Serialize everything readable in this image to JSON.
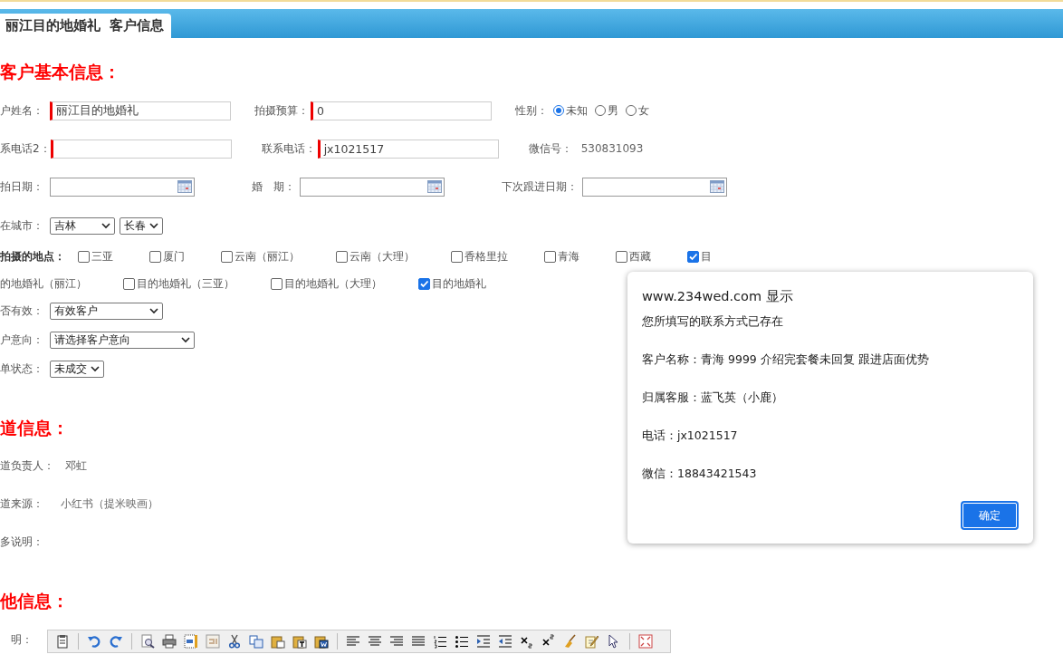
{
  "tab": {
    "title": "丽江目的地婚礼  客户信息"
  },
  "basic": {
    "heading": "客户基本信息：",
    "rows": [
      {
        "items": [
          {
            "kind": "text",
            "label": "户姓名：",
            "value": "丽江目的地婚礼",
            "required": true
          },
          {
            "kind": "text",
            "label": "拍摄预算：",
            "value": "0",
            "required": true
          },
          {
            "kind": "radio",
            "label": "性别：",
            "options": [
              {
                "label": "未知",
                "selected": true
              },
              {
                "label": "男",
                "selected": false
              },
              {
                "label": "女",
                "selected": false
              }
            ]
          }
        ]
      },
      {
        "items": [
          {
            "kind": "text",
            "label": "系电话2：",
            "required": true
          },
          {
            "kind": "text",
            "label": "联系电话：",
            "value": "jx1021517",
            "required": true
          },
          {
            "kind": "static",
            "label": "微信号：",
            "value": "530831093"
          }
        ]
      },
      {
        "items": [
          {
            "kind": "date",
            "label": "拍日期："
          },
          {
            "kind": "date",
            "label": "婚　期："
          },
          {
            "kind": "date",
            "label": "下次跟进日期："
          }
        ]
      },
      {
        "items": [
          {
            "kind": "select",
            "label": "在城市：",
            "values": [
              "吉林",
              "长春"
            ]
          }
        ]
      }
    ]
  },
  "places": {
    "label": "拍摄的地点：",
    "options": [
      {
        "label": "三亚",
        "checked": false
      },
      {
        "label": "厦门",
        "checked": false
      },
      {
        "label": "云南（丽江）",
        "checked": false
      },
      {
        "label": "云南（大理）",
        "checked": false
      },
      {
        "label": "香格里拉",
        "checked": false
      },
      {
        "label": "青海",
        "checked": false
      },
      {
        "label": "西藏",
        "checked": false
      },
      {
        "label": "目",
        "label_wrapped": "的地婚礼（丽江）",
        "checked": true
      },
      {
        "label": "目的地婚礼（三亚）",
        "checked": false
      },
      {
        "label": "目的地婚礼（大理）",
        "checked": false
      },
      {
        "label": "目的地婚礼",
        "checked": true
      }
    ]
  },
  "status_rows": [
    {
      "label": "否有效：",
      "value": "有效客户"
    },
    {
      "label": "户意向：",
      "value": "请选择客户意向"
    },
    {
      "label": "单状态：",
      "value": "未成交"
    }
  ],
  "channel": {
    "heading": "道信息：",
    "rows": [
      {
        "label": "道负责人：",
        "value": "邓虹"
      },
      {
        "label": "道来源：",
        "value": "小红书（提米映画）"
      },
      {
        "label": "多说明："
      }
    ]
  },
  "other": {
    "heading": "他信息：",
    "editor_label": "明："
  },
  "dialog": {
    "title": "www.234wed.com 显示",
    "lines": [
      "您所填写的联系方式已存在",
      "客户名称：青海 9999 介绍完套餐未回复  跟进店面优势",
      "归属客服：蓝飞英（小鹿）",
      "电话：jx1021517",
      "微信：18843421543"
    ],
    "button": "确定"
  }
}
